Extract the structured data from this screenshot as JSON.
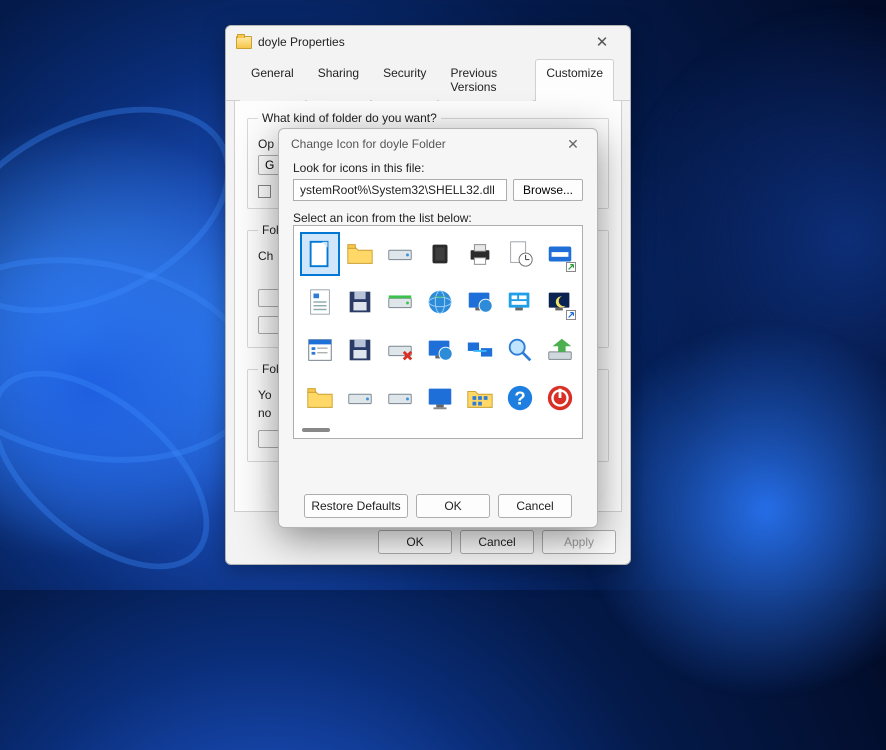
{
  "props": {
    "title": "doyle Properties",
    "tabs": [
      "General",
      "Sharing",
      "Security",
      "Previous Versions",
      "Customize"
    ],
    "active_tab": "Customize",
    "group1": {
      "legend": "What kind of folder do you want?",
      "optimize_label": "Op",
      "btn": "G"
    },
    "group2": {
      "legend": "Fol",
      "line1": "Ch"
    },
    "group3": {
      "legend": "Fol",
      "line1": "Yo",
      "line2": "no"
    },
    "buttons": {
      "ok": "OK",
      "cancel": "Cancel",
      "apply": "Apply"
    }
  },
  "change_icon": {
    "title": "Change Icon for doyle Folder",
    "look_label": "Look for icons in this file:",
    "path_value": "ystemRoot%\\System32\\SHELL32.dll",
    "browse": "Browse...",
    "select_label": "Select an icon from the list below:",
    "selected_index": 0,
    "icons": [
      "document",
      "folder",
      "drive",
      "chip",
      "printer",
      "clock-doc",
      "run-window",
      "doc-lines",
      "floppy",
      "drive-green",
      "globe",
      "monitor-globe",
      "control-panel",
      "moon-monitor",
      "list-window",
      "floppy-share",
      "drive-x",
      "globe-monitor",
      "network-monitors",
      "magnifier",
      "arrow-drive",
      "folder-open",
      "drive2",
      "drive3",
      "monitor",
      "grid-folder",
      "help",
      "power"
    ],
    "buttons": {
      "restore": "Restore Defaults",
      "ok": "OK",
      "cancel": "Cancel"
    }
  }
}
